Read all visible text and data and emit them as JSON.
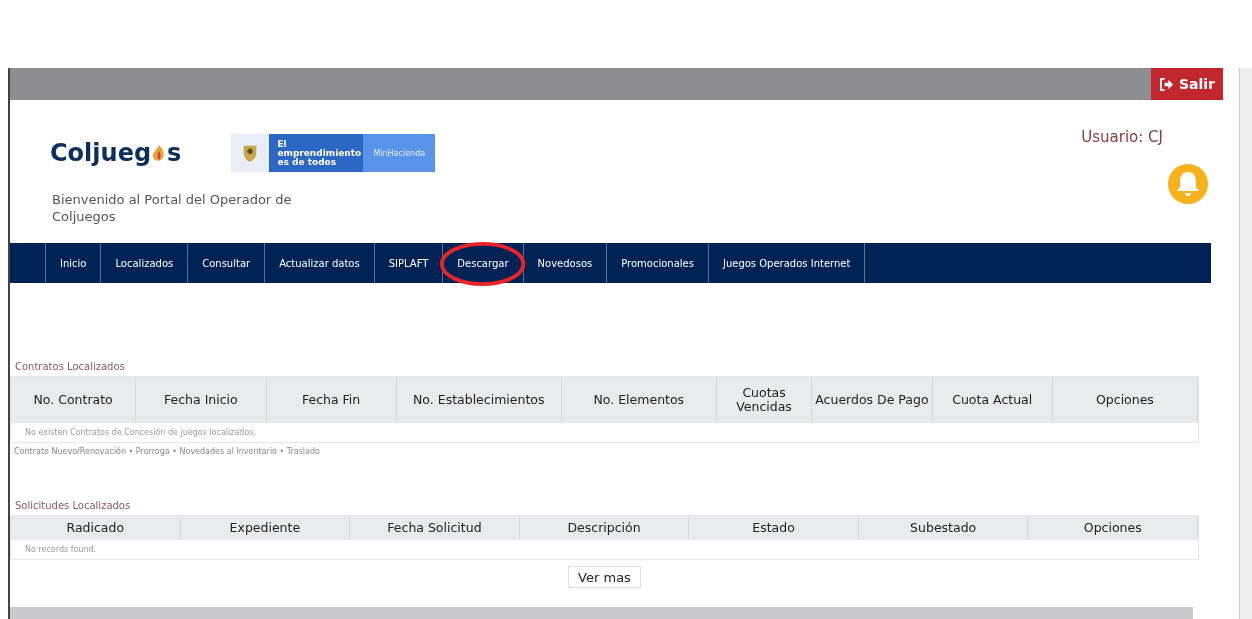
{
  "top_bar": {
    "logout_button": "Salir"
  },
  "header": {
    "logo": {
      "before": "Coljueg",
      "after": "s"
    },
    "gov_banner": {
      "slogan": "El emprendimiento es de todos",
      "ministry": "MinHacienda"
    },
    "welcome": "Bienvenido al Portal del Operador de Coljuegos",
    "user": "Usuario: CJ"
  },
  "nav": [
    {
      "label": "Inicio",
      "circled": false
    },
    {
      "label": "Localizados",
      "circled": false
    },
    {
      "label": "Consultar",
      "circled": false
    },
    {
      "label": "Actualizar datos",
      "circled": false
    },
    {
      "label": "SIPLAFT",
      "circled": false
    },
    {
      "label": "Descargar",
      "circled": true
    },
    {
      "label": "Novedosos",
      "circled": false
    },
    {
      "label": "Promocionales",
      "circled": false
    },
    {
      "label": "Juegos Operados Internet",
      "circled": false
    }
  ],
  "contracts": {
    "title": "Contratos Localizados",
    "columns": [
      "No. Contrato",
      "Fecha Inicio",
      "Fecha Fin",
      "No. Establecimientos",
      "No. Elementos",
      "Cuotas Vencidas",
      "Acuerdos De Pago",
      "Cuota Actual",
      "Opciones"
    ],
    "empty": "No existen Contratos de Concesión de juegos localizados.",
    "legend": "Contrato Nuevo/Renovación • Prorroga • Novedades al Inventario • Traslado"
  },
  "requests": {
    "title": "Solicitudes Localizados",
    "columns": [
      "Radicado",
      "Expediente",
      "Fecha Solicitud",
      "Descripción",
      "Estado",
      "Subestado",
      "Opciones"
    ],
    "empty": "No records found.",
    "more_button": "Ver mas"
  }
}
